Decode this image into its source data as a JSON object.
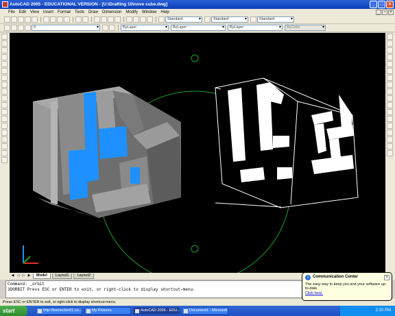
{
  "window": {
    "title": "AutoCAD 2005 - EDUCATIONAL VERSION - [U:\\Drafting 10\\nove cube.dwg]"
  },
  "menu": {
    "items": [
      "File",
      "Edit",
      "View",
      "Insert",
      "Format",
      "Tools",
      "Draw",
      "Dimension",
      "Modify",
      "Window",
      "Help"
    ]
  },
  "toolbar": {
    "text_style": "Standard",
    "dim_style": "Standard",
    "table_style": "Standard",
    "layer": "0",
    "color": "ByLayer",
    "linetype": "ByLayer",
    "lineweight": "ByLayer",
    "plot_style": "ByColor"
  },
  "layout_tabs": [
    "Model",
    "Layout1",
    "Layout2"
  ],
  "command_line": {
    "lines": [
      "Command: _orbit",
      "3DORBIT Press ESC or ENTER to exit, or right-click to display shortcut-menu."
    ]
  },
  "status": {
    "text": "Press ESC or ENTER to exit, or right-click to display shortcut-menu."
  },
  "balloon": {
    "title": "Communication Center",
    "text": "The easy way to keep you and your software up-to-date.",
    "link": "Click here."
  },
  "taskbar": {
    "start": "start",
    "tasks": [
      "http://brenecton01.co...",
      "My Pictures",
      "AutoCAD 2005 - EDU...",
      "Document1 - Microsoft..."
    ],
    "clock": "2:20 PM"
  },
  "colors": {
    "canvas": "#000000",
    "orbit": "#1fa02a",
    "accent_blue": "#1e90ff",
    "face_gray": "#8f8f8f"
  }
}
